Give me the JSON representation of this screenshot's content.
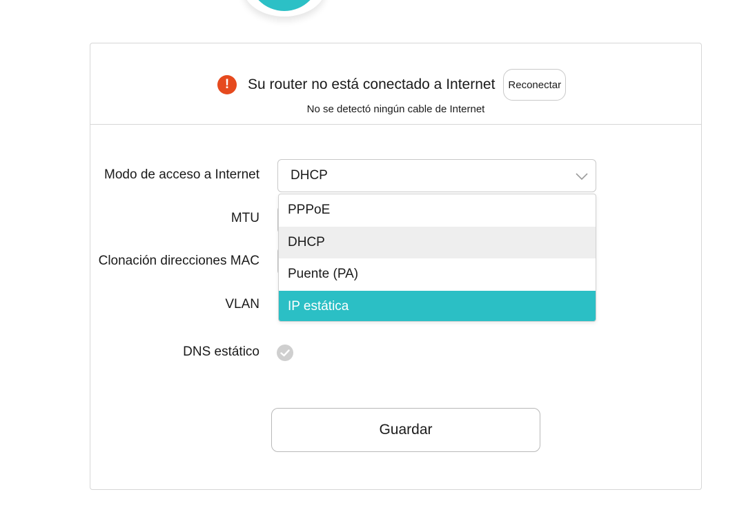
{
  "status": {
    "title": "Su router no está conectado a Internet",
    "subtitle": "No se detectó ningún cable de Internet",
    "reconnect_label": "Reconectar",
    "warning_icon": "exclamation-icon",
    "warning_glyph": "!",
    "warning_color": "#e64a1e"
  },
  "form": {
    "access_mode_label": "Modo de acceso a Internet",
    "access_mode_value": "DHCP",
    "mtu_label": "MTU",
    "mac_clone_label": "Clonación direcciones MAC",
    "vlan_label": "VLAN",
    "static_dns_label": "DNS estático",
    "static_dns_icon": "check-icon",
    "save_label": "Guardar"
  },
  "dropdown": {
    "options": [
      {
        "label": "PPPoE"
      },
      {
        "label": "DHCP",
        "state": "selected"
      },
      {
        "label": "Puente (PA)"
      },
      {
        "label": "IP estática",
        "state": "highlighted"
      }
    ]
  },
  "colors": {
    "accent": "#2bbfc5",
    "selected_bg": "#eeeeee",
    "border": "#c8c8c8"
  }
}
